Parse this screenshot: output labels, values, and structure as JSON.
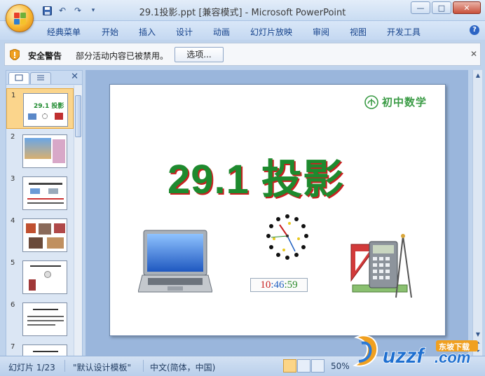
{
  "window": {
    "title": "29.1投影.ppt [兼容模式] - Microsoft PowerPoint",
    "buttons": {
      "minimize": "—",
      "maximize": "□",
      "close": "✕"
    }
  },
  "quick_access": {
    "icons": [
      "save-icon",
      "undo-icon",
      "redo-icon",
      "customize-icon"
    ]
  },
  "ribbon": {
    "tabs": [
      "经典菜单",
      "开始",
      "插入",
      "设计",
      "动画",
      "幻灯片放映",
      "审阅",
      "视图",
      "开发工具"
    ],
    "help": "?"
  },
  "security_bar": {
    "title": "安全警告",
    "message": "部分活动内容已被禁用。",
    "options_button": "选项...",
    "close": "✕"
  },
  "slides_pane": {
    "close": "✕",
    "slide_numbers": [
      "1",
      "2",
      "3",
      "4",
      "5",
      "6",
      "7"
    ],
    "selected": 1,
    "thumb1_title": "29.1 投影"
  },
  "slide": {
    "brand": "初中数学",
    "title": "29.1 投影",
    "clock": {
      "hours": "10",
      "minutes": ":46",
      "seconds": ":59"
    }
  },
  "status_bar": {
    "slide_info": "幻灯片 1/23",
    "template": "\"默认设计模板\"",
    "language": "中文(简体，中国)",
    "zoom": "50%",
    "zoom_minus": "−"
  },
  "watermark": {
    "brand": "uzzf",
    "domain": ".com",
    "tagline": "东坡下载"
  },
  "colors": {
    "accent": "#1e8a2e",
    "shadow": "#c82020",
    "ribbon_text": "#15428b"
  }
}
